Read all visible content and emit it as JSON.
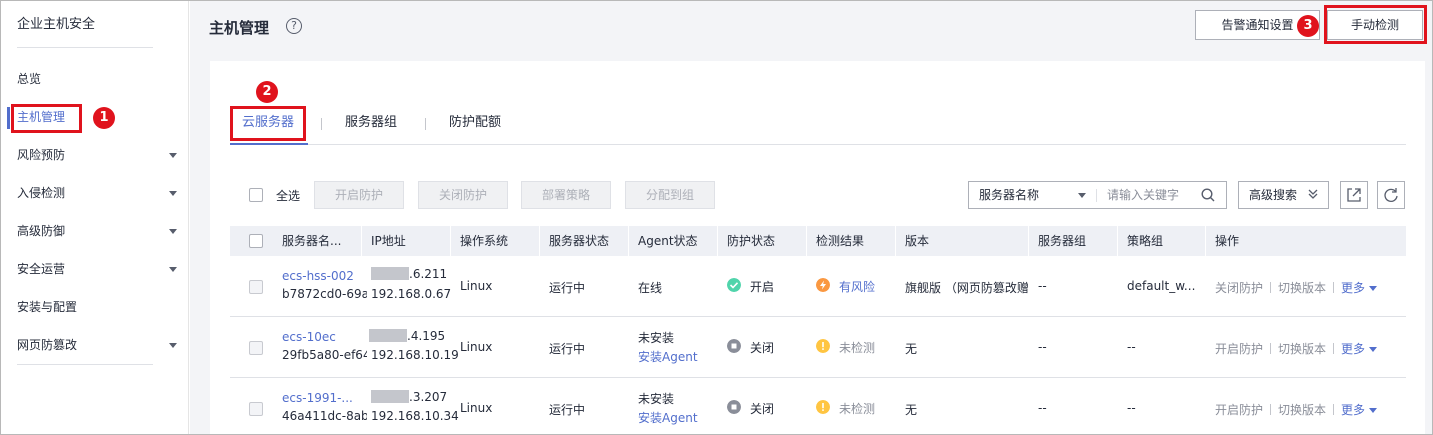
{
  "sidebar": {
    "title": "企业主机安全",
    "items": [
      {
        "label": "总览"
      },
      {
        "label": "主机管理"
      },
      {
        "label": "风险预防"
      },
      {
        "label": "入侵检测"
      },
      {
        "label": "高级防御"
      },
      {
        "label": "安全运营"
      },
      {
        "label": "安装与配置"
      },
      {
        "label": "网页防篡改"
      }
    ]
  },
  "header": {
    "title": "主机管理",
    "help_glyph": "?",
    "alert_settings_label": "告警通知设置",
    "manual_detect_label": "手动检测"
  },
  "tabs": [
    "云服务器",
    "服务器组",
    "防护配额"
  ],
  "toolbar": {
    "select_all": "全选",
    "enable_protection": "开启防护",
    "disable_protection": "关闭防护",
    "deploy_policy": "部署策略",
    "assign_group": "分配到组",
    "search_field": "服务器名称",
    "search_placeholder": "请输入关键字",
    "advanced_search": "高级搜索"
  },
  "table": {
    "columns": [
      "服务器名...",
      "IP地址",
      "操作系统",
      "服务器状态",
      "Agent状态",
      "防护状态",
      "检测结果",
      "版本",
      "服务器组",
      "策略组",
      "操作"
    ],
    "rows": [
      {
        "name": "ecs-hss-002",
        "id": "b7872cd0-69a",
        "ip_public_suffix": ".6.211",
        "ip_private": "192.168.0.67",
        "os": "Linux",
        "server_status": "运行中",
        "agent_status": "在线",
        "agent_install": "",
        "protection": "开启",
        "detection": "有风险",
        "edition": "旗舰版 （网页防篡改赠",
        "group": "--",
        "policy": "default_w...",
        "ops": [
          "关闭防护",
          "切换版本",
          "更多"
        ]
      },
      {
        "name": "ecs-10ec",
        "id": "29fb5a80-ef64",
        "ip_public_suffix": ".4.195",
        "ip_private": "192.168.10.19",
        "os": "Linux",
        "server_status": "运行中",
        "agent_status": "未安装",
        "agent_install": "安装Agent",
        "protection": "关闭",
        "detection": "未检测",
        "edition": "无",
        "group": "--",
        "policy": "--",
        "ops": [
          "开启防护",
          "切换版本",
          "更多"
        ]
      },
      {
        "name": "ecs-1991-...",
        "id": "46a411dc-8ab",
        "ip_public_suffix": ".3.207",
        "ip_private": "192.168.10.34",
        "os": "Linux",
        "server_status": "运行中",
        "agent_status": "未安装",
        "agent_install": "安装Agent",
        "protection": "关闭",
        "detection": "未检测",
        "edition": "无",
        "group": "--",
        "policy": "--",
        "ops": [
          "开启防护",
          "切换版本",
          "更多"
        ]
      }
    ]
  },
  "annotations": [
    "1",
    "2",
    "3"
  ],
  "colors": {
    "accent": "#526ecc",
    "annotation_red": "#e0131d",
    "status_on": "#50d4ab",
    "status_off": "#8a8e99",
    "risk": "#fa9841",
    "undetected": "#ffc542"
  }
}
